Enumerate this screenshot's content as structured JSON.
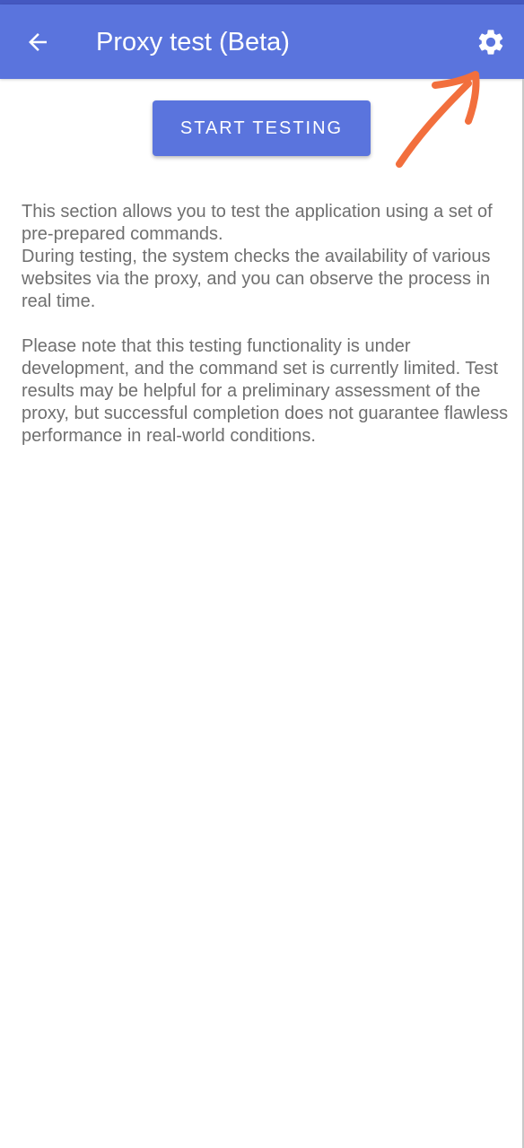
{
  "app_bar": {
    "title": "Proxy test (Beta)",
    "back_icon": "arrow-left-icon",
    "settings_icon": "gear-icon",
    "background_color": "#5a74dd"
  },
  "main": {
    "start_button_label": "START TESTING",
    "description": {
      "line_1": "This section allows you to test the application using a set of pre-prepared commands.",
      "line_2": "During testing, the system checks the availability of various websites via the proxy, and you can observe the process in real time.",
      "line_3": "Please note that this testing functionality is under development, and the command set is currently limited. Test results may be helpful for a preliminary assessment of the proxy, but successful completion does not guarantee flawless performance in real-world conditions."
    }
  },
  "annotation": {
    "type": "hand-drawn-arrow",
    "color": "#f26f3d",
    "points_to": "settings-button"
  }
}
